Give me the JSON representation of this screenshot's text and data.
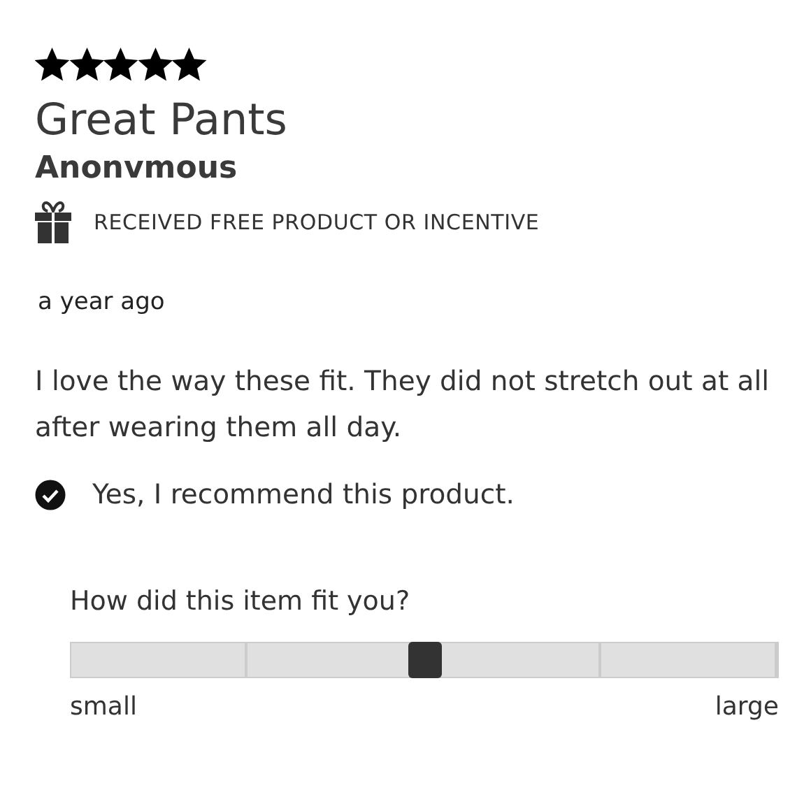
{
  "review": {
    "stars": 5,
    "title": "Great Pants",
    "author": "Anonvmous",
    "incentive": "RECEIVED FREE PRODUCT OR INCENTIVE",
    "date": "a year ago",
    "body": "I love the way these fit. They did not stretch out at all after wearing them all day.",
    "recommend": {
      "checked": true,
      "label": "Yes, I recommend this product."
    },
    "fit": {
      "question": "How did this item fit you?",
      "level": 0.5,
      "min_label": "small",
      "max_label": "large"
    }
  }
}
